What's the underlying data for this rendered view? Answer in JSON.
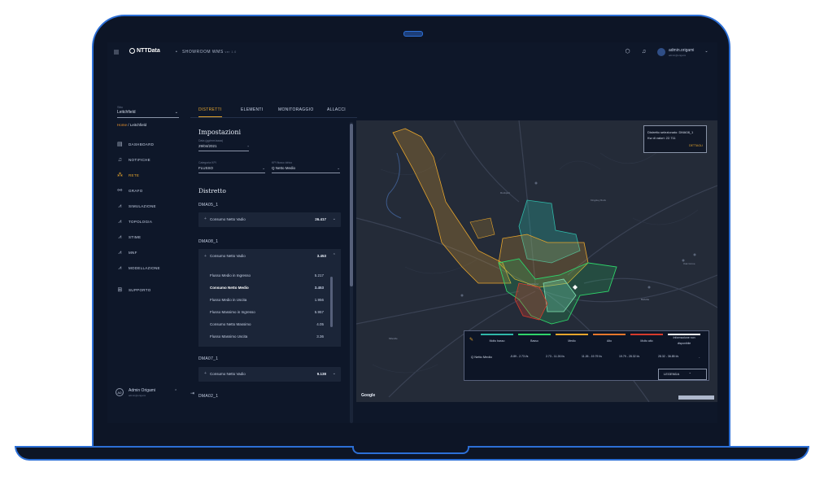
{
  "topbar": {
    "brand": "NTTData",
    "separator": "•",
    "app_title": "SHOWROOM WMS",
    "app_suffix": "ver 1.0",
    "user_name": "admin.origami",
    "user_sub": "admin@origami"
  },
  "sidebar": {
    "site_label": "Sito",
    "site_value": "Leitchfield",
    "breadcrumb_home": "Home",
    "breadcrumb_sep": "/",
    "breadcrumb_current": "Leitchfield",
    "items": [
      {
        "label": "DASHBOARD",
        "icon": "dashboard-icon"
      },
      {
        "label": "NOTIFICHE",
        "icon": "bell-icon"
      },
      {
        "label": "RETE",
        "icon": "network-icon",
        "active": true
      },
      {
        "label": "GRAFO",
        "icon": "graph-icon"
      },
      {
        "label": "SIMULAZIONE",
        "icon": "chart-icon"
      },
      {
        "label": "TOPOLOGIA",
        "icon": "chart-icon"
      },
      {
        "label": "STIME",
        "icon": "chart-icon"
      },
      {
        "label": "MNF",
        "icon": "chart-icon"
      },
      {
        "label": "MODELLAZIONE",
        "icon": "chart-icon"
      },
      {
        "label": "SUPPORTO",
        "icon": "support-icon"
      }
    ],
    "user": {
      "initials": "AO",
      "name": "Admin Origami",
      "sub": "admin@origami"
    }
  },
  "tabs": [
    "DISTRETTI",
    "ELEMENTI",
    "MONITORAGGIO",
    "ALLACCI"
  ],
  "settings": {
    "title": "Impostazioni",
    "date_label": "Data (gg/mm/aaaa)",
    "date_value": "29/04/2021",
    "category_label": "Categoria KPI",
    "category_value": "FLUSSO",
    "kpi_label": "KPI flusso idrico",
    "kpi_value": "Q Netto Medio"
  },
  "districts": {
    "title": "Distretto",
    "groups": [
      {
        "name": "DMA05_1",
        "label": "Consumo Netto Vadio",
        "value": "26.417"
      },
      {
        "name": "DMA08_1",
        "label": "Consumo Netto Vadio",
        "value": "3.453",
        "rows": [
          {
            "label": "Flusso Medio in Ingresso",
            "value": "5.217"
          },
          {
            "label": "Consumo Netto Medio",
            "value": "3.453",
            "bold": true
          },
          {
            "label": "Flusso Medio in Uscita",
            "value": "1.956"
          },
          {
            "label": "Flusso Massimo in Ingresso",
            "value": "5.957"
          },
          {
            "label": "Consumo Netto Massimo",
            "value": "4.05"
          },
          {
            "label": "Flusso Massimo Uscita",
            "value": "3.36"
          }
        ]
      },
      {
        "name": "DMA07_1",
        "label": "Consumo Netto Vadio",
        "value": "9.138"
      },
      {
        "name": "DMA02_1",
        "label": "",
        "value": ""
      }
    ]
  },
  "map": {
    "popup_line1": "Distretto selezionato: DMA08_1",
    "popup_line2": "Kw di valori: 22.711",
    "popup_link": "DETTAGLI",
    "legend": {
      "headers": [
        "Molto basso",
        "Basso",
        "Medio",
        "Alto",
        "Molto alto",
        "Informazione non disponibile"
      ],
      "row_label": "Q Netto Medio",
      "values": [
        "-5.89 - 2.73 l/s",
        "2.73 - 11.26 l/s",
        "11.26 - 19.79 l/s",
        "19.79 - 28.32 l/s",
        "28.32 - 36.85 l/s"
      ],
      "no_data": "-",
      "button_label": "LEGENDA",
      "colors": [
        "#2fb8a8",
        "#2fd36a",
        "#e6a52c",
        "#e6772c",
        "#d63b2c",
        "#ffffff"
      ]
    },
    "google": "Google",
    "towns": [
      "Rockport",
      "Kingsley Rock",
      "Oak Grove",
      "Bellville",
      "Leitchfield",
      "Mileville"
    ]
  }
}
